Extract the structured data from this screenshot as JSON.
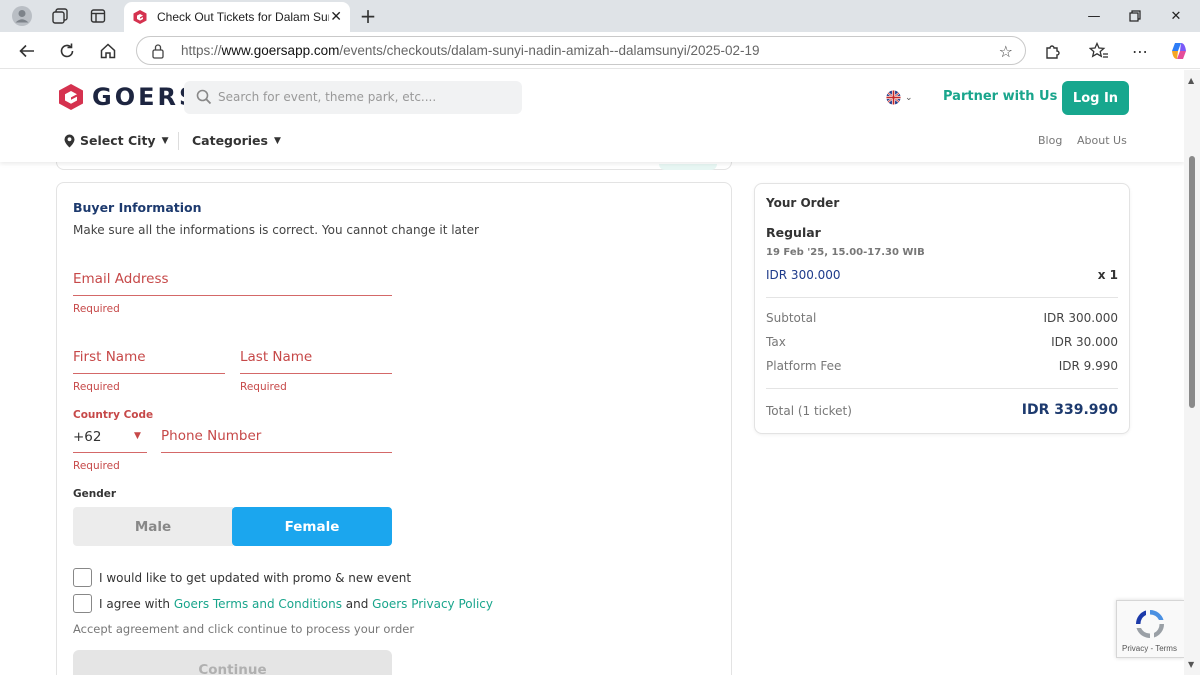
{
  "browser": {
    "tab_title": "Check Out Tickets for Dalam Sunyi",
    "url_prefix": "https://",
    "url_host": "www.goersapp.com",
    "url_path": "/events/checkouts/dalam-sunyi-nadin-amizah--dalamsunyi/2025-02-19"
  },
  "header": {
    "logo_text": "GOERS",
    "search_placeholder": "Search for event, theme park, etc....",
    "partner_label": "Partner with Us",
    "login_label": "Log In",
    "select_city_label": "Select City",
    "categories_label": "Categories",
    "blog_label": "Blog",
    "about_label": "About Us"
  },
  "buyer": {
    "title": "Buyer Information",
    "subtitle": "Make sure all the informations is correct. You cannot change it later",
    "email_label": "Email Address",
    "first_name_label": "First Name",
    "last_name_label": "Last Name",
    "required_text": "Required",
    "country_code_label": "Country Code",
    "country_code_value": "+62",
    "phone_label": "Phone Number",
    "gender_label": "Gender",
    "gender_male": "Male",
    "gender_female": "Female",
    "gender_selected": "Female",
    "promo_checkbox_label": "I would like to get updated with promo & new event",
    "agree_prefix": "I agree with ",
    "terms_link": "Goers Terms and Conditions",
    "agree_and": " and ",
    "privacy_link": "Goers Privacy Policy",
    "accept_note": "Accept agreement and click continue to process your order",
    "continue_label": "Continue"
  },
  "order": {
    "title": "Your Order",
    "ticket_name": "Regular",
    "ticket_date": "19 Feb '25, 15.00-17.30 WIB",
    "ticket_price": "IDR 300.000",
    "ticket_qty": "x 1",
    "subtotal_label": "Subtotal",
    "subtotal_value": "IDR 300.000",
    "tax_label": "Tax",
    "tax_value": "IDR 30.000",
    "platform_fee_label": "Platform Fee",
    "platform_fee_value": "IDR 9.990",
    "total_label": "Total (1 ticket)",
    "total_value": "IDR 339.990"
  },
  "recaptcha": {
    "text": "Privacy - Terms"
  },
  "colors": {
    "brand_green": "#17a78e",
    "brand_blue": "#1d3a6e",
    "error_red": "#c64848",
    "female_selected": "#1ba6ee"
  }
}
